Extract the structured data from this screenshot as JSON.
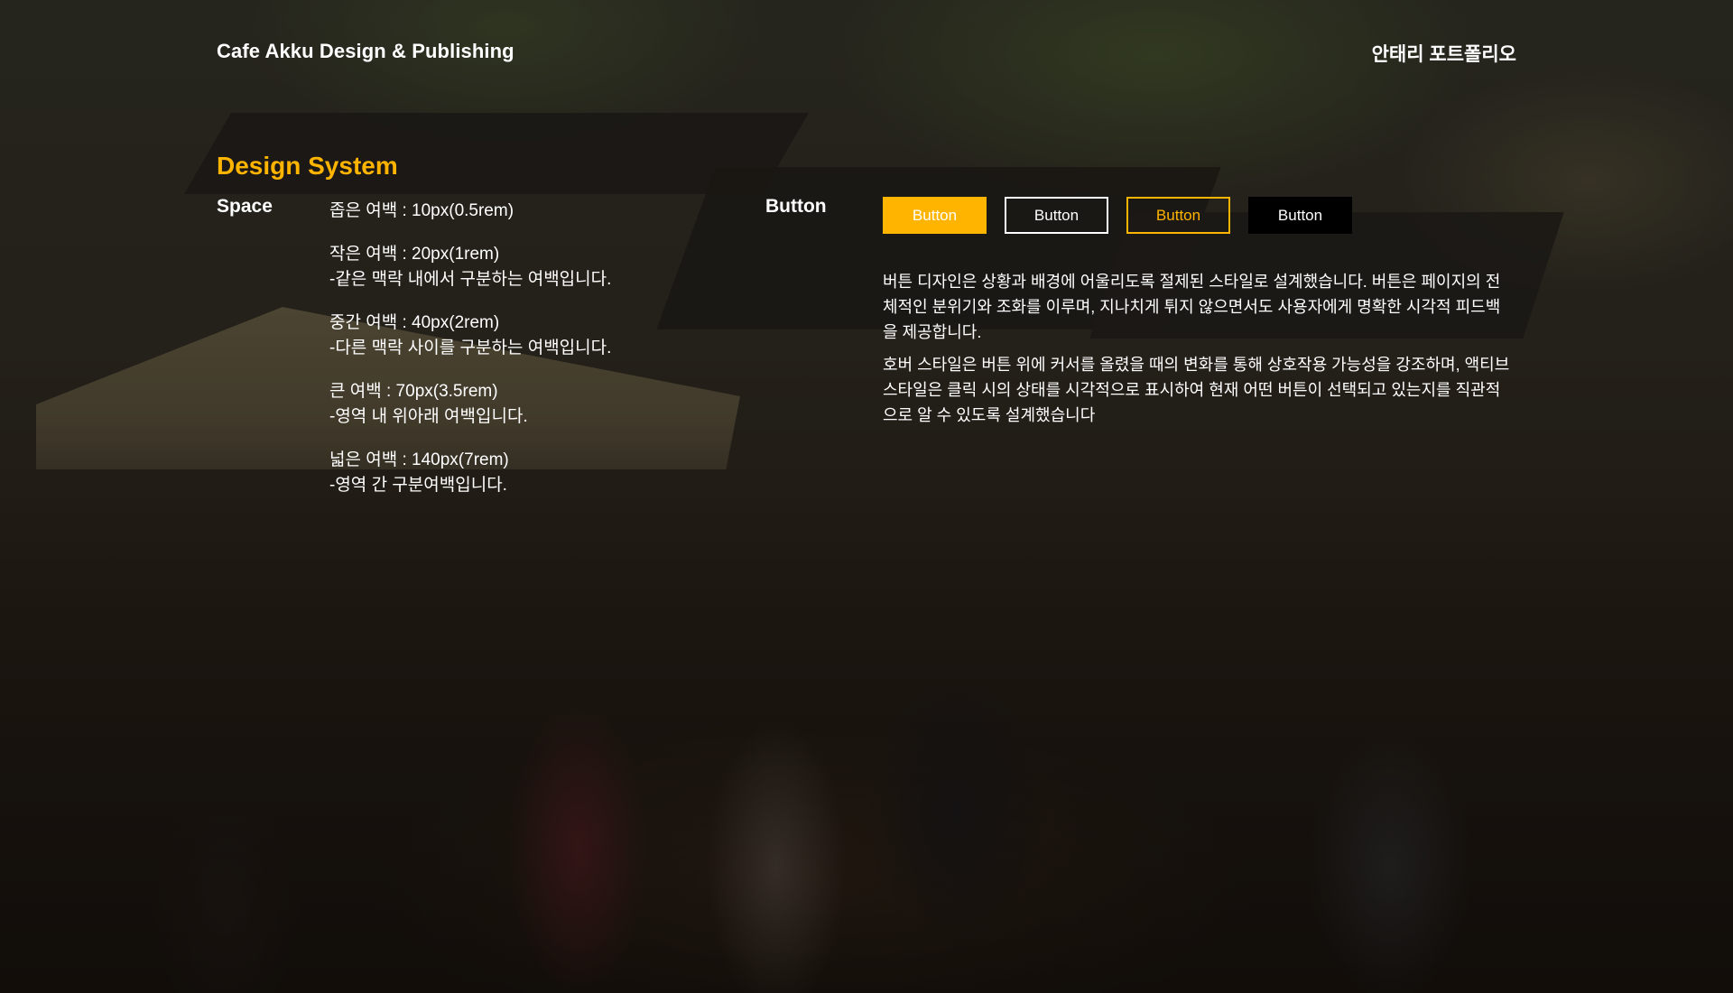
{
  "header": {
    "brand": "Cafe Akku Design & Publishing",
    "portfolio_link": "안태리 포트폴리오"
  },
  "design_system": {
    "title": "Design System",
    "space": {
      "label": "Space",
      "items": [
        {
          "title": "좁은 여백 : 10px(0.5rem)",
          "desc": ""
        },
        {
          "title": "작은 여백 : 20px(1rem)",
          "desc": "-같은 맥락 내에서 구분하는 여백입니다."
        },
        {
          "title": "중간 여백 : 40px(2rem)",
          "desc": "-다른 맥락 사이를 구분하는 여백입니다."
        },
        {
          "title": "큰 여백 : 70px(3.5rem)",
          "desc": "-영역 내 위아래 여백입니다."
        },
        {
          "title": "넓은 여백 : 140px(7rem)",
          "desc": "-영역 간 구분여백입니다."
        }
      ]
    },
    "button": {
      "label": "Button",
      "samples": [
        {
          "label": "Button",
          "style": "default"
        },
        {
          "label": "Button",
          "style": "outline"
        },
        {
          "label": "Button",
          "style": "hover"
        },
        {
          "label": "Button",
          "style": "active"
        }
      ],
      "description": [
        "버튼 디자인은 상황과 배경에 어울리도록 절제된 스타일로 설계했습니다. 버튼은 페이지의 전체적인 분위기와 조화를 이루며, 지나치게 튀지 않으면서도 사용자에게 명확한 시각적 피드백을 제공합니다.",
        "호버 스타일은 버튼 위에 커서를 올렸을 때의 변화를 통해 상호작용 가능성을 강조하며, 액티브 스타일은 클릭 시의 상태를 시각적으로 표시하여 현재 어떤 버튼이 선택되고 있는지를 직관적으로 알 수 있도록 설계했습니다"
      ]
    }
  },
  "colors": {
    "accent": "#ffb400",
    "text": "#ffffff",
    "active_bg": "#000000"
  }
}
